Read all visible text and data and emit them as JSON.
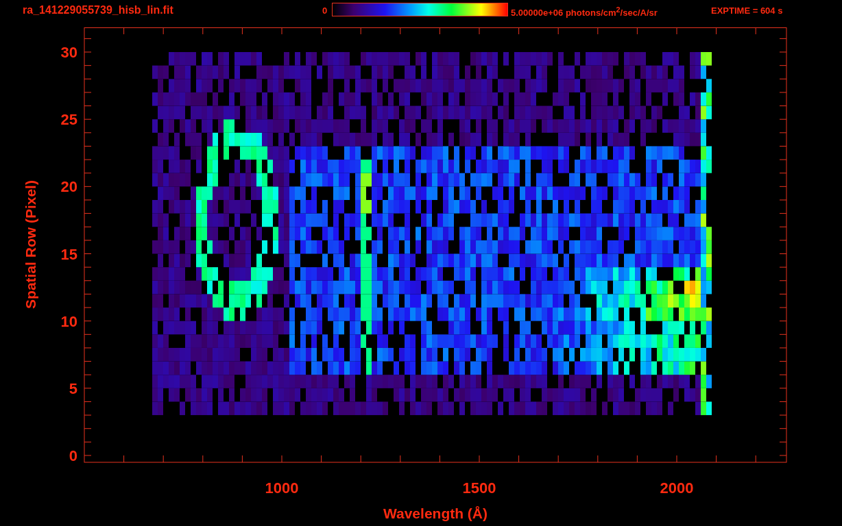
{
  "title": "ra_141229055739_hisb_lin.fit",
  "colorbar": {
    "min_label": "0",
    "max_label": "5.00000e+06 photons/cm$^{2}$/sec/A/sr"
  },
  "exptime": "EXPTIME = 604 s",
  "x_axis": {
    "label": "Wavelength (Å)",
    "ticks": [
      "1000",
      "1500",
      "2000"
    ]
  },
  "y_axis": {
    "label": "Spatial Row (Pixel)",
    "ticks": [
      "30",
      "25",
      "20",
      "15",
      "10",
      "5",
      "0"
    ]
  }
}
